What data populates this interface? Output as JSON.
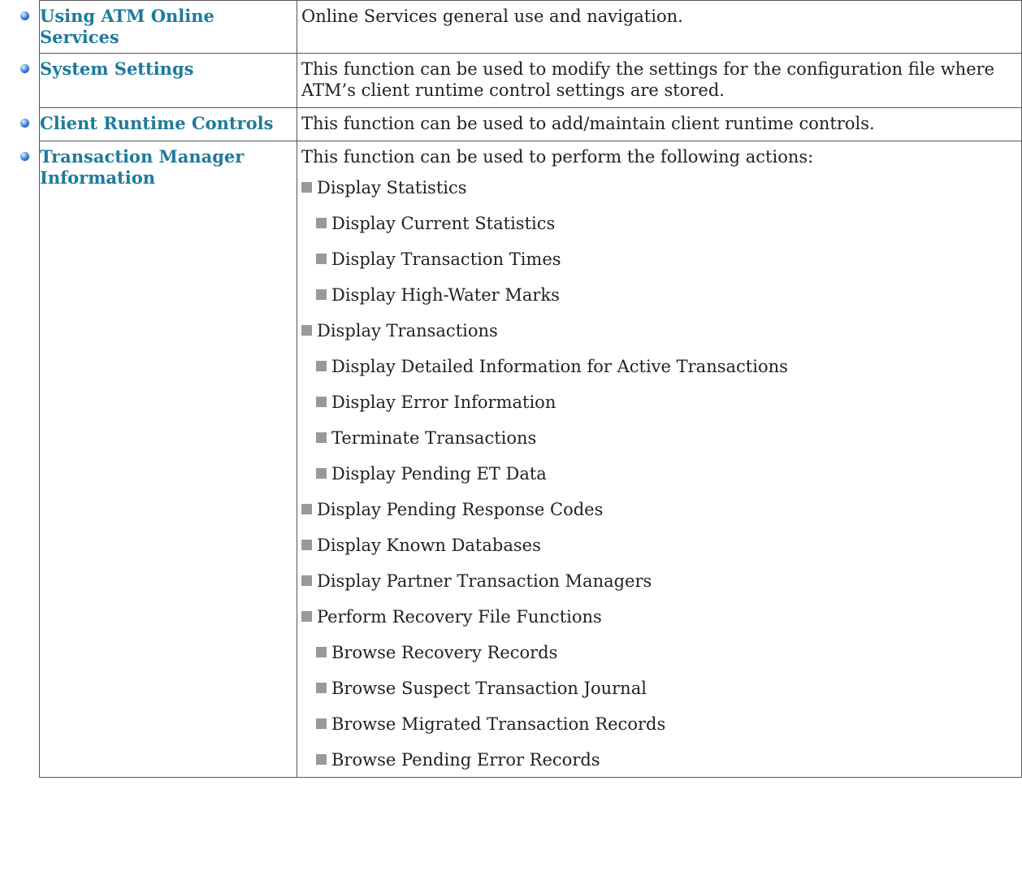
{
  "rows": [
    {
      "topic": "Using ATM Online Services",
      "description": "Online Services general use and navigation."
    },
    {
      "topic": "System Settings",
      "description": "This function can be used to modify the settings for the configuration file where ATM’s client runtime control settings are stored."
    },
    {
      "topic": "Client Runtime Controls",
      "description": "This function can be used to add/maintain client runtime controls."
    },
    {
      "topic": "Transaction Manager Information",
      "description": "This function can be used to perform the following actions:",
      "actions": [
        "Display Statistics",
        "Display Current Statistics",
        "Display Transaction Times",
        "Display High-Water Marks",
        "Display Transactions",
        "Display Detailed Information for Active Transactions",
        "Display Error Information",
        "Terminate Transactions",
        "Display Pending ET Data",
        "Display Pending Response Codes",
        "Display Known Databases",
        "Display Partner Transaction Managers",
        "Perform Recovery File Functions",
        "Browse Recovery Records",
        "Browse Suspect Transaction Journal",
        "Browse Migrated Transaction Records",
        "Browse Pending Error Records"
      ]
    }
  ],
  "icons": {
    "row_bullet": "blue-sphere-bullet-icon",
    "list_bullet": "gray-square-bullet-icon"
  },
  "colors": {
    "link": "#1e7a9e",
    "border": "#555555",
    "square_bullet": "#999999"
  }
}
